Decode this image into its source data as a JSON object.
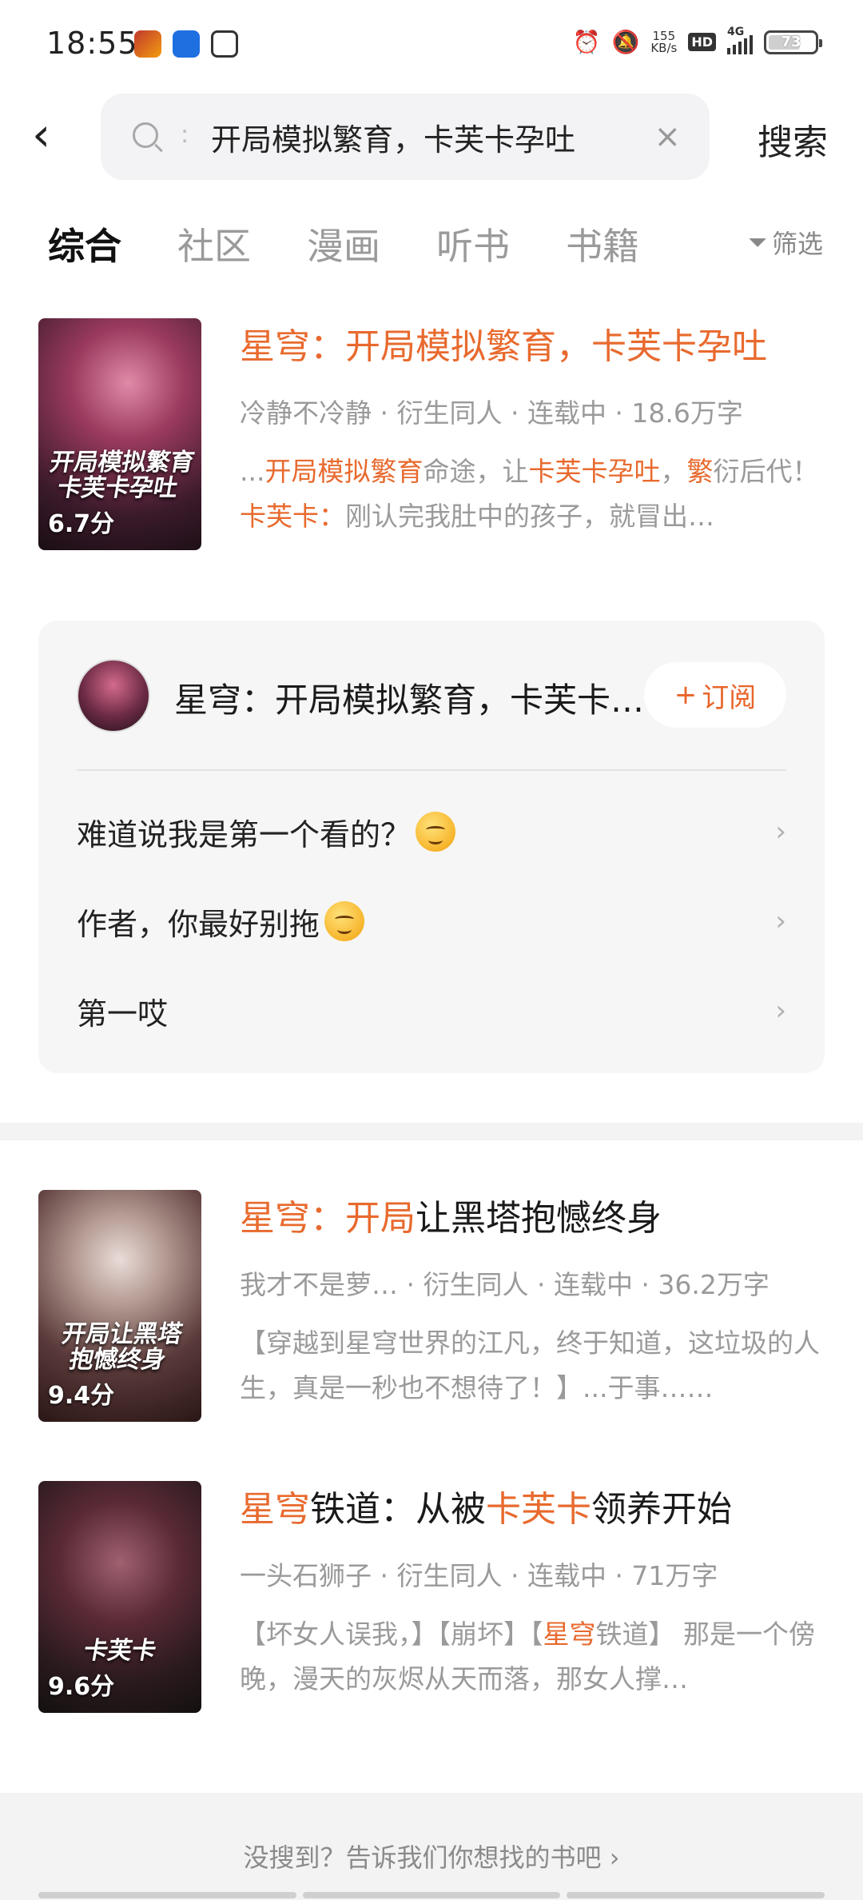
{
  "status_bar": {
    "time": "18:55",
    "net_speed_value": "155",
    "net_speed_unit": "KB/s",
    "hd_label": "HD",
    "network_label": "4G",
    "battery_level": "73"
  },
  "search": {
    "query": "开局模拟繁育，卡芙卡孕吐",
    "button_label": "搜索"
  },
  "tabs": [
    {
      "label": "综合",
      "active": true
    },
    {
      "label": "社区",
      "active": false
    },
    {
      "label": "漫画",
      "active": false
    },
    {
      "label": "听书",
      "active": false
    },
    {
      "label": "书籍",
      "active": false
    }
  ],
  "filter_label": "筛选",
  "books": [
    {
      "title_parts": [
        {
          "text": "星穹：开局模拟繁育，卡芙卡孕吐",
          "hl": true
        }
      ],
      "meta": "冷静不冷静 · 衍生同人 · 连载中 · 18.6万字",
      "desc_parts": [
        {
          "text": "...",
          "hl": false
        },
        {
          "text": "开局模拟繁育",
          "hl": true
        },
        {
          "text": "命途，让",
          "hl": false
        },
        {
          "text": "卡芙卡孕吐",
          "hl": true
        },
        {
          "text": "，",
          "hl": false
        },
        {
          "text": "繁",
          "hl": true
        },
        {
          "text": "衍后代！ ",
          "hl": false
        },
        {
          "text": "卡芙卡",
          "hl": true
        },
        {
          "text": "：",
          "hl": true
        },
        {
          "text": "刚认完我肚中的孩子，就冒出…",
          "hl": false
        }
      ],
      "cover_title": "开局模拟繁育 卡芙卡孕吐",
      "rating": "6.7分"
    },
    {
      "title_parts": [
        {
          "text": "星穹：开局",
          "hl": true
        },
        {
          "text": "让黑塔抱憾终身",
          "hl": false
        }
      ],
      "meta": "我才不是萝…  · 衍生同人 · 连载中 · 36.2万字",
      "desc_parts": [
        {
          "text": "【穿越到星穹世界的江凡，终于知道，这垃圾的人生，真是一秒也不想待了！】...于事……",
          "hl": false
        }
      ],
      "cover_title": "开局让黑塔 抱憾终身",
      "rating": "9.4分"
    },
    {
      "title_parts": [
        {
          "text": "星穹",
          "hl": true
        },
        {
          "text": "铁道：从被",
          "hl": false
        },
        {
          "text": "卡芙卡",
          "hl": true
        },
        {
          "text": "领养开始",
          "hl": false
        }
      ],
      "meta": "一头石狮子 · 衍生同人 · 连载中 · 71万字",
      "desc_parts": [
        {
          "text": "【坏女人误我，】【崩坏】【",
          "hl": false
        },
        {
          "text": "星穹",
          "hl": true
        },
        {
          "text": "铁道】 那是一个傍晚，漫天的灰烬从天而落，那女人撑…",
          "hl": false
        }
      ],
      "cover_title": "卡芙卡",
      "rating": "9.6分"
    }
  ],
  "community": {
    "title": "星穹：开局模拟繁育，卡芙卡孕吐",
    "subscribe_label": "订阅",
    "posts": [
      {
        "text": "难道说我是第一个看的？",
        "emoji": "drooling-face-emoji"
      },
      {
        "text": "作者，你最好别拖",
        "emoji": "smiling-face-emoji"
      },
      {
        "text": "第一哎",
        "emoji": ""
      }
    ]
  },
  "feedback_text": "没搜到？告诉我们你想找的书吧",
  "colors": {
    "accent": "#e86a2e",
    "muted": "#9a9a9a",
    "card_bg": "#f6f6f6"
  }
}
